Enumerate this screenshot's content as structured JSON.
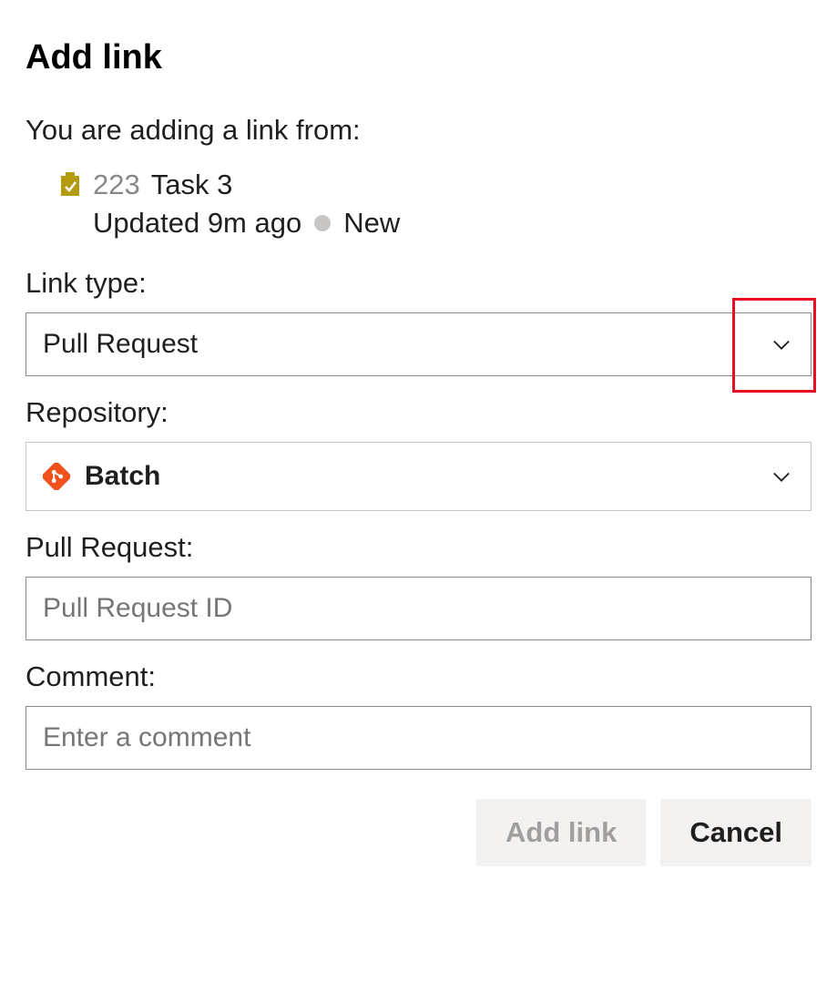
{
  "dialog": {
    "title": "Add link",
    "intro": "You are adding a link from:"
  },
  "sourceItem": {
    "iconName": "task-icon",
    "id": "223",
    "title": "Task 3",
    "updated": "Updated 9m ago",
    "state": "New"
  },
  "fields": {
    "linkType": {
      "label": "Link type:",
      "value": "Pull Request"
    },
    "repository": {
      "label": "Repository:",
      "value": "Batch"
    },
    "pullRequest": {
      "label": "Pull Request:",
      "placeholder": "Pull Request ID",
      "value": ""
    },
    "comment": {
      "label": "Comment:",
      "placeholder": "Enter a comment",
      "value": ""
    }
  },
  "buttons": {
    "primary": "Add link",
    "cancel": "Cancel"
  }
}
